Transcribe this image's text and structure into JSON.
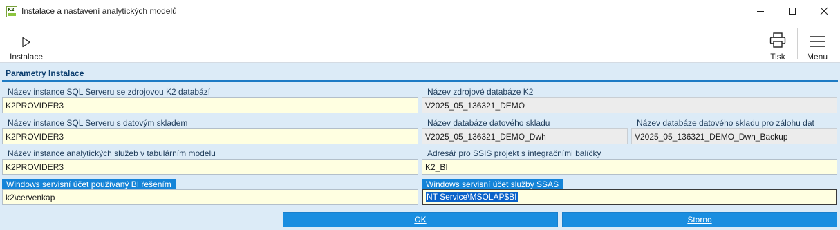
{
  "window": {
    "title": "Instalace a nastavení analytických modelů",
    "icon_text": "K2"
  },
  "toolbar": {
    "install_label": "Instalace",
    "print_label": "Tisk",
    "menu_label": "Menu"
  },
  "section": {
    "title": "Parametry Instalace"
  },
  "fields": {
    "sql_source_label": "Název instance SQL Serveru se zdrojovou K2 databází",
    "sql_source_value": "K2PROVIDER3",
    "source_db_label": "Název zdrojové databáze K2",
    "source_db_value": "V2025_05_136321_DEMO",
    "sql_dwh_label": "Název instance SQL Serveru s datovým skladem",
    "sql_dwh_value": "K2PROVIDER3",
    "dwh_db_label": "Název databáze datového skladu",
    "dwh_db_value": "V2025_05_136321_DEMO_Dwh",
    "dwh_backup_label": "Název databáze datového skladu pro zálohu dat",
    "dwh_backup_value": "V2025_05_136321_DEMO_Dwh_Backup",
    "ssas_instance_label": "Název instance analytických služeb v tabulárním modelu",
    "ssas_instance_value": "K2PROVIDER3",
    "ssis_dir_label": "Adresář pro SSIS projekt s integračními balíčky",
    "ssis_dir_value": "K2_BI",
    "bi_account_label": "Windows servisní účet používaný BI řešením",
    "bi_account_value": "k2\\cervenkap",
    "ssas_account_label": "Windows servisní účet služby SSAS",
    "ssas_account_value": "NT Service\\MSOLAP$BI"
  },
  "buttons": {
    "ok_label": "OK",
    "cancel_label": "Storno"
  },
  "colors": {
    "accent": "#1a8ee0",
    "panel_bg": "#dcebf7",
    "edit_bg": "#ffffe1",
    "readonly_bg": "#ececec"
  }
}
